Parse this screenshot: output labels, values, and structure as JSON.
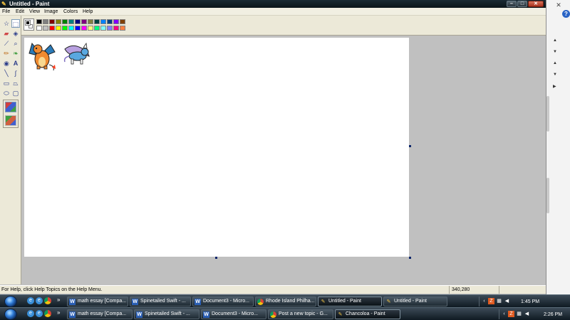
{
  "window": {
    "title": "Untitled - Paint"
  },
  "menu": [
    "File",
    "Edit",
    "View",
    "Image",
    "Colors",
    "Help"
  ],
  "status": {
    "help_text": "For Help, click Help Topics on the Help Menu.",
    "coords": "340,280"
  },
  "colors": {
    "foreground": "#000000",
    "background": "#ffffff",
    "palette_row1": [
      "#000000",
      "#808080",
      "#800000",
      "#808000",
      "#008000",
      "#008080",
      "#000080",
      "#800080",
      "#808040",
      "#004040",
      "#0080ff",
      "#004080",
      "#8000ff",
      "#804000"
    ],
    "palette_row2": [
      "#ffffff",
      "#c0c0c0",
      "#ff0000",
      "#ffff00",
      "#00ff00",
      "#00ffff",
      "#0000ff",
      "#ff00ff",
      "#ffff80",
      "#00ff80",
      "#80ffff",
      "#8080ff",
      "#ff0080",
      "#ff8040"
    ]
  },
  "tools": [
    "free-select",
    "rect-select",
    "eraser",
    "fill",
    "color-picker",
    "magnifier",
    "pencil",
    "brush",
    "airbrush",
    "text",
    "line",
    "curve",
    "rectangle",
    "polygon",
    "ellipse",
    "rounded-rect"
  ],
  "taskbar_top": {
    "buttons": [
      {
        "label": "math essay [Compa...",
        "icon": "word"
      },
      {
        "label": "Spinetailed Swift - ...",
        "icon": "word"
      },
      {
        "label": "Document3 - Micro...",
        "icon": "word"
      },
      {
        "label": "Rhode Island Philha...",
        "icon": "chrome"
      },
      {
        "label": "Untitled - Paint",
        "icon": "paint",
        "active": true
      },
      {
        "label": "Untitled - Paint",
        "icon": "paint"
      }
    ],
    "clock": "1:45 PM"
  },
  "taskbar_bottom": {
    "buttons": [
      {
        "label": "math essay [Compa...",
        "icon": "word"
      },
      {
        "label": "Spinetailed Swift - ...",
        "icon": "word"
      },
      {
        "label": "Document3 - Micro...",
        "icon": "word"
      },
      {
        "label": "Post a new topic - G...",
        "icon": "chrome"
      },
      {
        "label": "Chancoloa - Paint",
        "icon": "paint",
        "active": true
      }
    ],
    "clock": "2:26 PM"
  }
}
